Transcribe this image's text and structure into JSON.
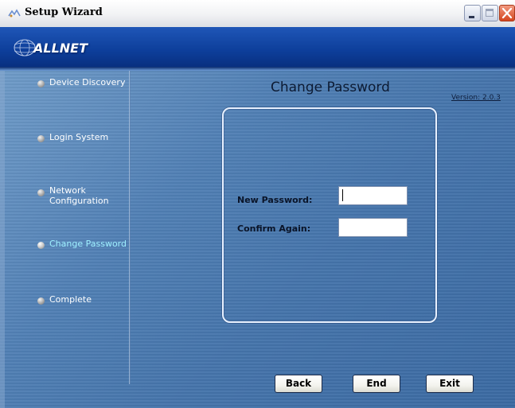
{
  "window": {
    "title": "Setup Wizard",
    "controls": [
      "minimize",
      "maximize",
      "close"
    ]
  },
  "banner": {
    "logo_text": "ALLNET"
  },
  "sidebar": {
    "steps": [
      {
        "label": "Device Discovery",
        "icon": "step-dot-icon",
        "active": false
      },
      {
        "label": "Login System",
        "icon": "step-dot-icon",
        "active": false
      },
      {
        "label_line1": "Network",
        "label_line2": "Configuration",
        "icon": "step-dot-icon",
        "active": false
      },
      {
        "label": "Change Password",
        "icon": "step-dot-icon",
        "active": true
      },
      {
        "label": "Complete",
        "icon": "step-dot-icon",
        "active": false
      }
    ]
  },
  "main": {
    "title": "Change Password",
    "version": "Version: 2.0.3",
    "form": {
      "new_password_label": "New Password:",
      "new_password_value": "",
      "confirm_label": "Confirm Again:",
      "confirm_value": ""
    }
  },
  "buttons": {
    "back": "Back",
    "end": "End",
    "exit": "Exit"
  },
  "colors": {
    "banner": "#0d3e9a",
    "body": "#4f7eb4",
    "active_step": "#9ff0ff"
  }
}
